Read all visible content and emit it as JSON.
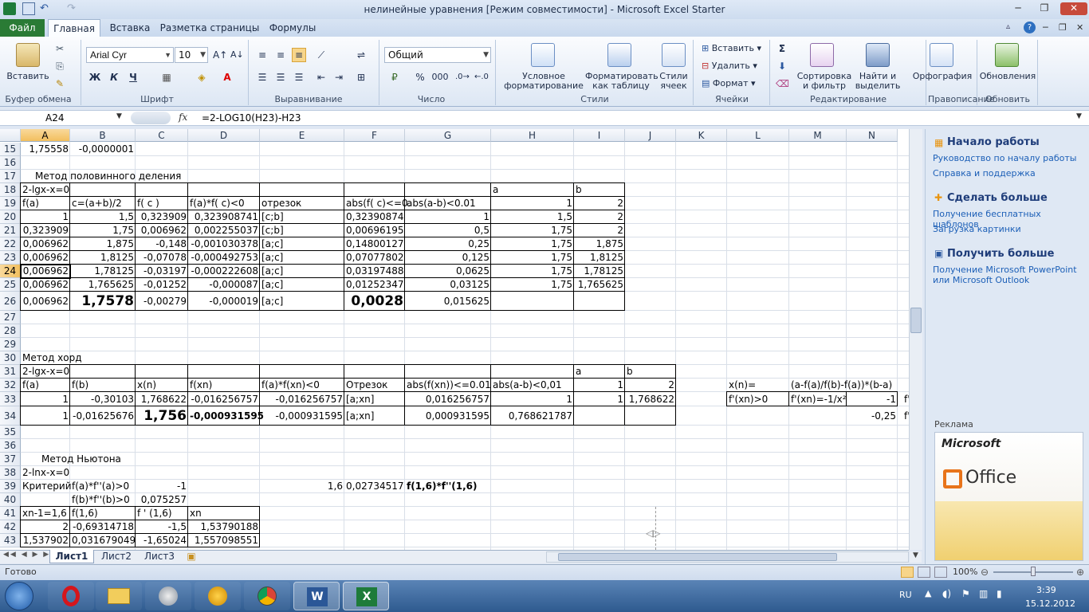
{
  "window": {
    "title": "нелинейные уравнения  [Режим совместимости]  -  Microsoft Excel Starter"
  },
  "ribbon": {
    "tabs": [
      "Файл",
      "Главная",
      "Вставка",
      "Разметка страницы",
      "Формулы"
    ],
    "font_name": "Arial Cyr",
    "font_size": "10",
    "number_format": "Общий",
    "groups": {
      "clipboard": "Буфер обмена",
      "font": "Шрифт",
      "alignment": "Выравнивание",
      "number": "Число",
      "styles": "Стили",
      "cells": "Ячейки",
      "editing": "Редактирование",
      "proofing": "Правописание",
      "update": "Обновить"
    },
    "buttons": {
      "paste": "Вставить",
      "bold": "Ж",
      "italic": "К",
      "underline": "Ч",
      "percent": "%",
      "thousands": "000",
      "cond_format_1": "Условное",
      "cond_format_2": "форматирование",
      "format_table_1": "Форматировать",
      "format_table_2": "как таблицу",
      "cell_styles_1": "Стили",
      "cell_styles_2": "ячеек",
      "insert": "Вставить",
      "delete": "Удалить",
      "format": "Формат",
      "sort_1": "Сортировка",
      "sort_2": "и фильтр",
      "find_1": "Найти и",
      "find_2": "выделить",
      "spelling": "Орфография",
      "updates": "Обновления"
    }
  },
  "formula_bar": {
    "name_box": "A24",
    "fx": "fx",
    "formula": "=2-LOG10(H23)-H23"
  },
  "columns": [
    "A",
    "B",
    "C",
    "D",
    "E",
    "F",
    "G",
    "H",
    "I",
    "J",
    "K",
    "L",
    "M",
    "N"
  ],
  "rows": [
    "15",
    "16",
    "17",
    "18",
    "19",
    "20",
    "21",
    "22",
    "23",
    "24",
    "25",
    "26",
    "27",
    "28",
    "29",
    "30",
    "31",
    "32",
    "33",
    "34",
    "35",
    "36",
    "37",
    "38",
    "39",
    "40",
    "41",
    "42",
    "43"
  ],
  "cells": {
    "A15": "1,75558",
    "B15": "-0,0000001",
    "A17": "Метод половинного деления",
    "A18": "2-lgx-x=0",
    "H18": "a",
    "I18": "b",
    "A19": "f(a)",
    "B19": "c=(a+b)/2",
    "C19": "f( c )",
    "D19": "f(a)*f( c)<0",
    "E19": "отрезок",
    "F19": "abs(f( c)<=0.",
    "G19": "abs(a-b)<0.01",
    "H19": "1",
    "I19": "2",
    "A20": "1",
    "B20": "1,5",
    "C20": "0,323909",
    "D20": "0,323908741",
    "E20": "[c;b]",
    "F20": "0,32390874",
    "G20": "1",
    "H20": "1,5",
    "I20": "2",
    "A21": "0,323909",
    "B21": "1,75",
    "C21": "0,006962",
    "D21": "0,002255037",
    "E21": "[c;b]",
    "F21": "0,00696195",
    "G21": "0,5",
    "H21": "1,75",
    "I21": "2",
    "A22": "0,006962",
    "B22": "1,875",
    "C22": "-0,148",
    "D22": "-0,001030378",
    "E22": "[a;c]",
    "F22": "0,14800127",
    "G22": "0,25",
    "H22": "1,75",
    "I22": "1,875",
    "A23": "0,006962",
    "B23": "1,8125",
    "C23": "-0,07078",
    "D23": "-0,000492753",
    "E23": "[a;c]",
    "F23": "0,07077802",
    "G23": "0,125",
    "H23": "1,75",
    "I23": "1,8125",
    "A24": "0,006962",
    "B24": "1,78125",
    "C24": "-0,03197",
    "D24": "-0,000222608",
    "E24": "[a;c]",
    "F24": "0,03197488",
    "G24": "0,0625",
    "H24": "1,75",
    "I24": "1,78125",
    "A25": "0,006962",
    "B25": "1,765625",
    "C25": "-0,01252",
    "D25": "-0,000087",
    "E25": "[a;c]",
    "F25": "0,01252347",
    "G25": "0,03125",
    "H25": "1,75",
    "I25": "1,765625",
    "A26": "0,006962",
    "B26": "1,7578",
    "C26": "-0,00279",
    "D26": "-0,000019",
    "E26": "[a;c]",
    "F26": "0,0028",
    "G26": "0,015625",
    "A30": "Метод хорд",
    "A31": "2-lgx-x=0",
    "I31": "a",
    "J31": "b",
    "A32": "f(a)",
    "B32": "f(b)",
    "C32": "x(n)",
    "D32": "f(xn)",
    "E32": "f(a)*f(xn)<0",
    "F32": "Отрезок",
    "G32": "abs(f(xn))<=0.01",
    "H32": "abs(a-b)<0,01",
    "I32": "1",
    "J32": "2",
    "L32": "x(n)=",
    "M32": "(a-f(a)/f(b)-f(a))*(b-a)",
    "A33": "1",
    "B33": "-0,30103",
    "C33": "1,768622",
    "D33": "-0,016256757",
    "E33": "-0,016256757",
    "F33": "[a;xn]",
    "G33": "0,016256757",
    "H33": "1",
    "I33": "1",
    "J33": "1,768622",
    "L33": "f'(xn)>0",
    "M33": "f'(xn)=-1/x²",
    "N33": "-1",
    "O33": "f'",
    "A34": "1",
    "B34": "-0,01625676",
    "C34": "1,756",
    "D34": "-0,000931595",
    "E34": "-0,000931595",
    "F34": "[a;xn]",
    "G34": "0,000931595",
    "H34": "0,768621787",
    "N34": "-0,25",
    "O34": "f'",
    "A37": "Метод Ньютона",
    "A38": "2-lnx-x=0",
    "A39": "Критерий",
    "B39": "f(a)*f''(a)>0",
    "C39": "-1",
    "E39": "1,6",
    "F39": "0,02734517",
    "G39": "f(1,6)*f''(1,6)",
    "B40": "f(b)*f''(b)>0",
    "C40": "0,075257",
    "A41": "xn-1=1,6",
    "B41": "f(1,6)",
    "C41": "f ' (1,6)",
    "D41": "xn",
    "A42": "2",
    "B42": "-0,69314718",
    "C42": "-1,5",
    "D42": "1,53790188",
    "A43": "1,537902",
    "B43": "0,031679049",
    "C43": "-1,65024",
    "D43": "1,557098551"
  },
  "sheet_tabs": [
    "Лист1",
    "Лист2",
    "Лист3"
  ],
  "status": {
    "ready": "Готово",
    "zoom": "100%"
  },
  "side_pane": {
    "h1": "Начало работы",
    "l1": "Руководство по началу работы",
    "l2": "Справка и поддержка",
    "h2": "Сделать больше",
    "l3": "Получение бесплатных шаблонов",
    "l4": "Загрузка картинки",
    "h3": "Получить больше",
    "l5": "Получение Microsoft PowerPoint или Microsoft Outlook",
    "ad_label": "Реклама",
    "ad_brand": "Microsoft",
    "ad_product": "Office"
  },
  "taskbar": {
    "lang": "RU",
    "time": "3:39",
    "date": "15.12.2012"
  },
  "colors": {
    "file_tab": "#2a7b35",
    "selection": "#f2bf5e",
    "excel_green": "#1e7b3a",
    "word_blue": "#2b5797"
  }
}
